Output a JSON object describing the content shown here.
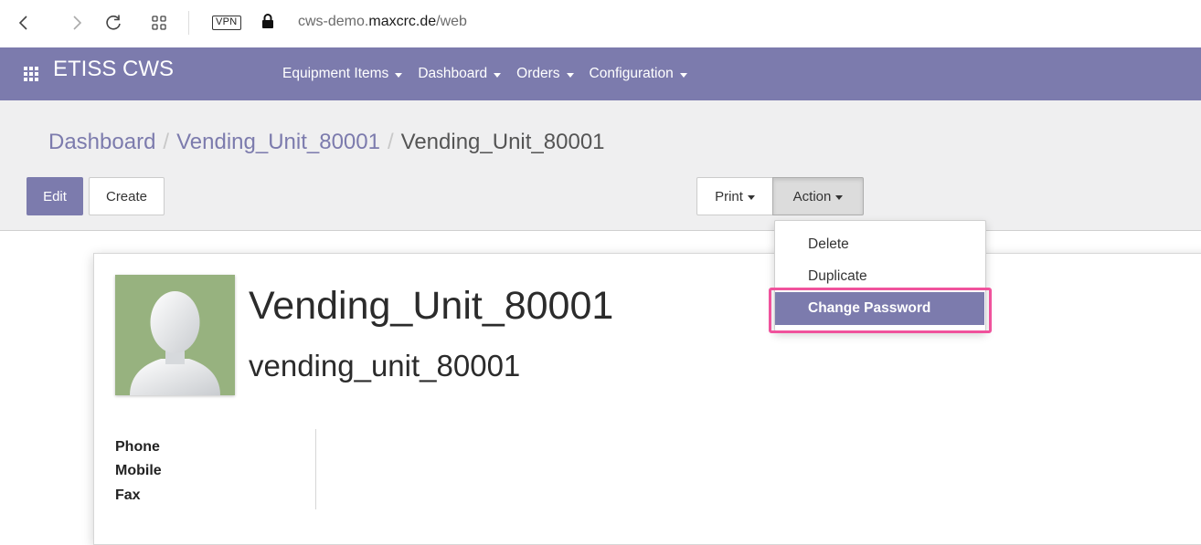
{
  "browser": {
    "url_prefix": "cws-demo.",
    "url_host": "maxcrc.de",
    "url_path": "/web",
    "vpn_label": "VPN"
  },
  "app_nav": {
    "brand": "ETISS CWS",
    "menu": [
      {
        "label": "Equipment Items"
      },
      {
        "label": "Dashboard"
      },
      {
        "label": "Orders"
      },
      {
        "label": "Configuration"
      }
    ]
  },
  "breadcrumb": {
    "items": [
      "Dashboard",
      "Vending_Unit_80001"
    ],
    "separator": "/",
    "current": "Vending_Unit_80001"
  },
  "toolbar": {
    "edit_label": "Edit",
    "create_label": "Create",
    "print_label": "Print",
    "action_label": "Action"
  },
  "action_menu": {
    "items": [
      "Delete",
      "Duplicate"
    ],
    "active": "Change Password"
  },
  "record": {
    "name": "Vending_Unit_80001",
    "login": "vending_unit_80001",
    "fields": [
      "Phone",
      "Mobile",
      "Fax"
    ]
  },
  "colors": {
    "brand": "#7c7bad",
    "highlight": "#f0529c",
    "avatar_bg": "#97b27f"
  }
}
